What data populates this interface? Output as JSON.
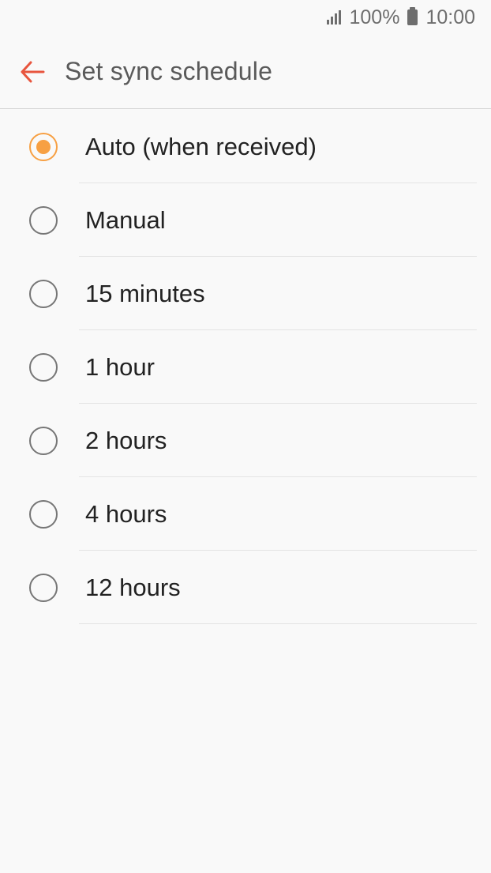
{
  "status_bar": {
    "battery_percent": "100%",
    "time": "10:00",
    "signal_icon": "signal-bars-icon",
    "battery_icon": "battery-full-icon"
  },
  "header": {
    "back_icon": "arrow-left-icon",
    "title": "Set sync schedule",
    "accent_color": "#e8553e"
  },
  "options": [
    {
      "label": "Auto (when received)",
      "selected": true
    },
    {
      "label": "Manual",
      "selected": false
    },
    {
      "label": "15 minutes",
      "selected": false
    },
    {
      "label": "1 hour",
      "selected": false
    },
    {
      "label": "2 hours",
      "selected": false
    },
    {
      "label": "4 hours",
      "selected": false
    },
    {
      "label": "12 hours",
      "selected": false
    }
  ],
  "colors": {
    "radio_selected": "#f7a043",
    "radio_unselected": "#767676",
    "background": "#f9f9f9"
  }
}
